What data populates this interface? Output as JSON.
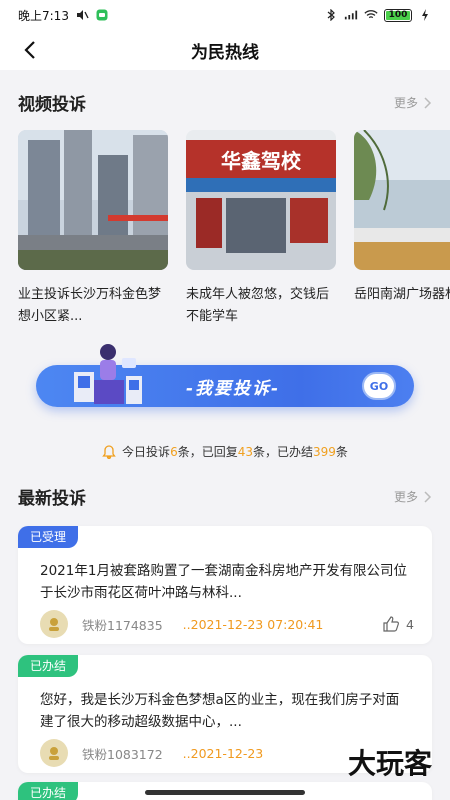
{
  "status_bar": {
    "time": "晚上7:13",
    "battery": "100"
  },
  "nav": {
    "title": "为民热线"
  },
  "video_section": {
    "title": "视频投诉",
    "more": "更多",
    "items": [
      {
        "title": "业主投诉长沙万科金色梦想小区紧..."
      },
      {
        "title": "未成年人被忽悠，交钱后不能学车"
      },
      {
        "title": "岳阳南湖广场器材缺失"
      }
    ]
  },
  "banner": {
    "text": "-我要投诉-",
    "go": "GO"
  },
  "stats": {
    "prefix": "今日投诉",
    "complaints": "6",
    "unit1": "条，已回复",
    "replied": "43",
    "unit2": "条，已办结",
    "done": "399",
    "unit3": "条"
  },
  "latest_section": {
    "title": "最新投诉",
    "more": "更多"
  },
  "complaints": [
    {
      "badge": "已受理",
      "badge_color": "#3f6fe8",
      "body": "2021年1月被套路购置了一套湖南金科房地产开发有限公司位于长沙市雨花区荷叶冲路与林科...",
      "user": "铁粉1174835",
      "time": "..2021-12-23 07:20:41",
      "likes": "4"
    },
    {
      "badge": "已办结",
      "badge_color": "#2ec27e",
      "body": "您好，我是长沙万科金色梦想a区的业主，现在我们房子对面建了很大的移动超级数据中心，...",
      "user": "铁粉1083172",
      "time": "..2021-12-23",
      "likes": ""
    },
    {
      "badge": "已办结",
      "badge_color": "#2ec27e"
    }
  ],
  "watermark": "大玩客"
}
